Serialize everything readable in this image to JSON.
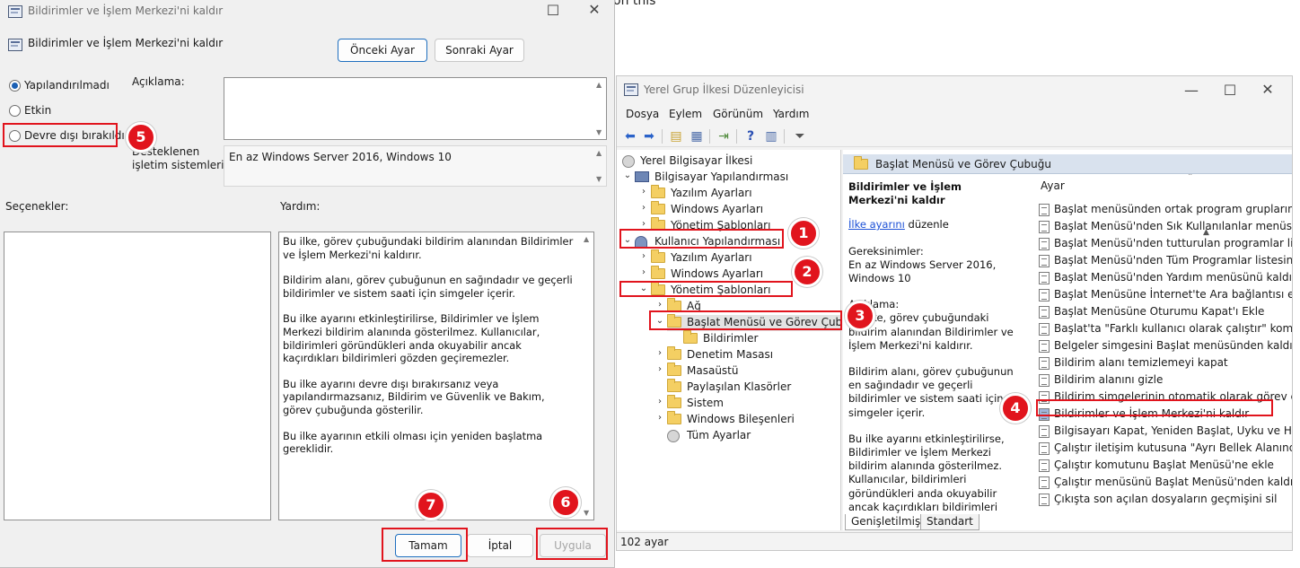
{
  "background": {
    "text": "on this"
  },
  "dialog": {
    "title": "Bildirimler ve İşlem Merkezi'ni kaldır",
    "policy_name": "Bildirimler ve İşlem Merkezi'ni kaldır",
    "prev_button": "Önceki Ayar",
    "next_button": "Sonraki Ayar",
    "radios": {
      "not_configured": "Yapılandırılmadı",
      "enabled": "Etkin",
      "disabled": "Devre dışı bırakıldı",
      "selected": "not_configured"
    },
    "comment_label": "Açıklama:",
    "supported_label": "Desteklenen\nişletim sistemleri:",
    "supported_value": "En az Windows Server 2016, Windows 10",
    "options_label": "Seçenekler:",
    "help_label": "Yardım:",
    "help_paragraphs": [
      "Bu ilke, görev çubuğundaki bildirim alanından Bildirimler ve İşlem Merkezi'ni kaldırır.",
      "Bildirim alanı, görev çubuğunun en sağındadır ve geçerli bildirimler ve sistem saati için simgeler içerir.",
      "Bu ilke ayarını etkinleştirilirse, Bildirimler ve İşlem Merkezi bildirim alanında gösterilmez. Kullanıcılar, bildirimleri göründükleri anda okuyabilir ancak kaçırdıkları bildirimleri gözden geçiremezler.",
      "Bu ilke ayarını devre dışı bırakırsanız veya yapılandırmazsanız, Bildirim ve Güvenlik ve Bakım, görev çubuğunda gösterilir.",
      "Bu ilke ayarının etkili olması için yeniden başlatma gereklidir."
    ],
    "ok_button": "Tamam",
    "cancel_button": "İptal",
    "apply_button": "Uygula"
  },
  "editor": {
    "title": "Yerel Grup İlkesi Düzenleyicisi",
    "menu": [
      "Dosya",
      "Eylem",
      "Görünüm",
      "Yardım"
    ],
    "tree": [
      "Yerel Bilgisayar İlkesi",
      "Bilgisayar Yapılandırması",
      "Yazılım Ayarları",
      "Windows Ayarları",
      "Yönetim Şablonları",
      "Kullanıcı Yapılandırması",
      "Yazılım Ayarları",
      "Windows Ayarları",
      "Yönetim Şablonları",
      "Ağ",
      "Başlat Menüsü ve Görev Çubuğu",
      "Bildirimler",
      "Denetim Masası",
      "Masaüstü",
      "Paylaşılan Klasörler",
      "Sistem",
      "Windows Bileşenleri",
      "Tüm Ayarlar"
    ],
    "header": "Başlat Menüsü ve Görev Çubuğu",
    "desc_title": "Bildirimler ve İşlem Merkezi'ni kaldır",
    "desc_link": "İlke ayarını",
    "desc_link_suffix": " düzenle",
    "desc_req_label": "Gereksinimler:",
    "desc_req_value": "En az Windows Server 2016, Windows 10",
    "desc_desc_label": "Açıklama:",
    "desc_paragraphs": [
      "Bu ilke, görev çubuğundaki bildirim alanından Bildirimler ve İşlem Merkezi'ni kaldırır.",
      "Bildirim alanı, görev çubuğunun en sağındadır ve geçerli bildirimler ve sistem saati için simgeler içerir.",
      "Bu ilke ayarını etkinleştirilirse, Bildirimler ve İşlem Merkezi bildirim alanında gösterilmez. Kullanıcılar, bildirimleri göründükleri anda okuyabilir ancak kaçırdıkları bildirimleri gözden geçiremezler."
    ],
    "list_header": "Ayar",
    "list": [
      "Başlat menüsünden ortak program gruplarını kaldır",
      "Başlat Menüsü'nden Sık Kullanılanlar menüsünü kaldır",
      "Başlat Menüsü'nden tutturulan programlar listesini kaldır",
      "Başlat Menüsü'nden Tüm Programlar listesini kaldır",
      "Başlat Menüsü'nden Yardım menüsünü kaldır",
      "Başlat Menüsüne İnternet'te Ara bağlantısı ekle",
      "Başlat Menüsüne Oturumu Kapat'ı Ekle",
      "Başlat'ta \"Farklı kullanıcı olarak çalıştır\" komutunu göster",
      "Belgeler simgesini Başlat menüsünden kaldır",
      "Bildirim alanı temizlemeyi kapat",
      "Bildirim alanını gizle",
      "Bildirim simgelerinin otomatik olarak görev çubuğunda",
      "Bildirimler ve İşlem Merkezi'ni kaldır",
      "Bilgisayarı Kapat, Yeniden Başlat, Uyku ve Hazırda Beklet",
      "Çalıştır iletişim kutusuna \"Ayrı Bellek Alanında Çalıştır\"",
      "Çalıştır komutunu Başlat Menüsü'ne ekle",
      "Çalıştır menüsünü Başlat Menüsü'nden kaldır",
      "Çıkışta son açılan dosyaların geçmişini sil"
    ],
    "tab_extended": "Genişletilmiş",
    "tab_standard": "Standart",
    "status": "102 ayar"
  },
  "markers": [
    "1",
    "2",
    "3",
    "4",
    "5",
    "6",
    "7"
  ]
}
